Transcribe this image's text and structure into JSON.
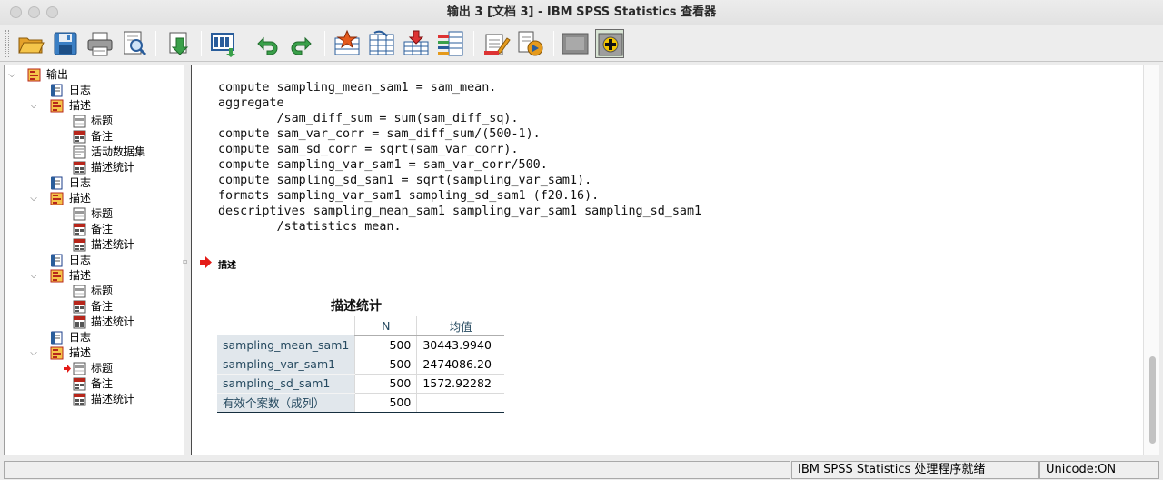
{
  "window": {
    "title": "输出 3 [文档 3] - IBM SPSS Statistics 查看器"
  },
  "toolbar": {
    "buttons": [
      "open-icon",
      "save-icon",
      "print-icon",
      "print-preview-icon",
      "export-icon",
      "dialog-recall-icon",
      "undo-icon",
      "redo-icon",
      "goto-data-icon",
      "goto-case-icon",
      "goto-variable-icon",
      "variables-icon",
      "insert-heading-icon",
      "insert-text-icon",
      "hide-icon",
      "show-icon"
    ]
  },
  "outline": {
    "root": "输出",
    "log": "日志",
    "descriptives": "描述",
    "title": "标题",
    "notes": "备注",
    "active_dataset": "活动数据集",
    "descriptive_statistics": "描述统计"
  },
  "syntax": {
    "lines": [
      "compute sampling_mean_sam1 = sam_mean.",
      "aggregate",
      "        /sam_diff_sum = sum(sam_diff_sq).",
      "compute sam_var_corr = sam_diff_sum/(500-1).",
      "compute sam_sd_corr = sqrt(sam_var_corr).",
      "compute sampling_var_sam1 = sam_var_corr/500.",
      "compute sampling_sd_sam1 = sqrt(sampling_var_sam1).",
      "formats sampling_var_sam1 sampling_sd_sam1 (f20.16).",
      "descriptives sampling_mean_sam1 sampling_var_sam1 sampling_sd_sam1",
      "        /statistics mean."
    ]
  },
  "output_item": {
    "label": "描述"
  },
  "table": {
    "title": "描述统计",
    "headers": [
      "",
      "N",
      "均值"
    ],
    "rows": [
      [
        "sampling_mean_sam1",
        "500",
        "30443.9940"
      ],
      [
        "sampling_var_sam1",
        "500",
        "2474086.20"
      ],
      [
        "sampling_sd_sam1",
        "500",
        "1572.92282"
      ],
      [
        "有效个案数（成列）",
        "500",
        ""
      ]
    ]
  },
  "status": {
    "processor": "IBM SPSS Statistics 处理程序就绪",
    "unicode": "Unicode:ON"
  }
}
